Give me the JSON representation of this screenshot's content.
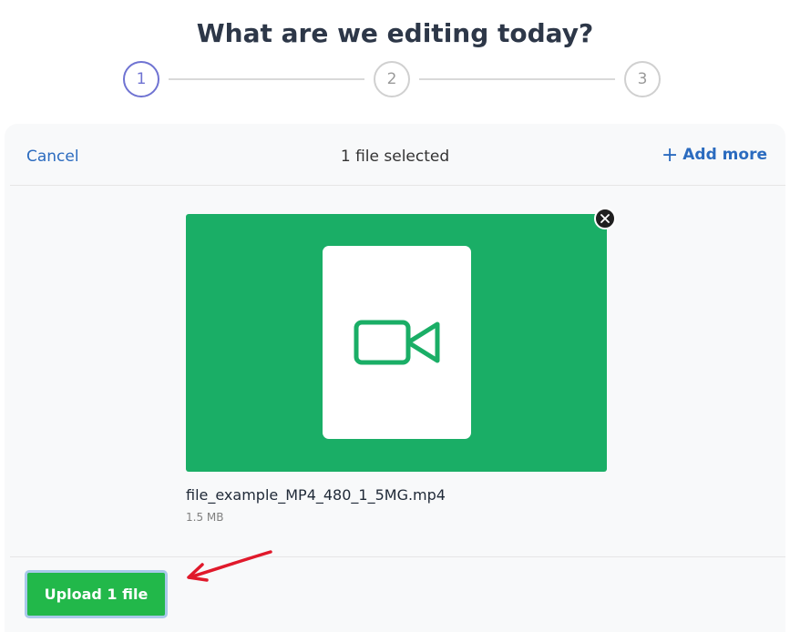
{
  "page": {
    "title": "What are we editing today?"
  },
  "stepper": {
    "steps": [
      {
        "label": "1",
        "state": "active"
      },
      {
        "label": "2",
        "state": "inactive"
      },
      {
        "label": "3",
        "state": "inactive"
      }
    ]
  },
  "panel": {
    "cancel_label": "Cancel",
    "selected_text": "1 file selected",
    "add_more_label": "Add more",
    "add_more_icon": "plus-icon"
  },
  "file": {
    "name": "file_example_MP4_480_1_5MG.mp4",
    "size": "1.5 MB",
    "thumb_icon": "video-camera-icon",
    "remove_icon": "close-icon"
  },
  "footer": {
    "upload_label": "Upload 1 file"
  },
  "colors": {
    "accent": "#6f73d2",
    "link": "#2b6bbf",
    "thumb_bg": "#1aae66",
    "upload_button": "#22b84a",
    "annotation": "#e0192b"
  }
}
